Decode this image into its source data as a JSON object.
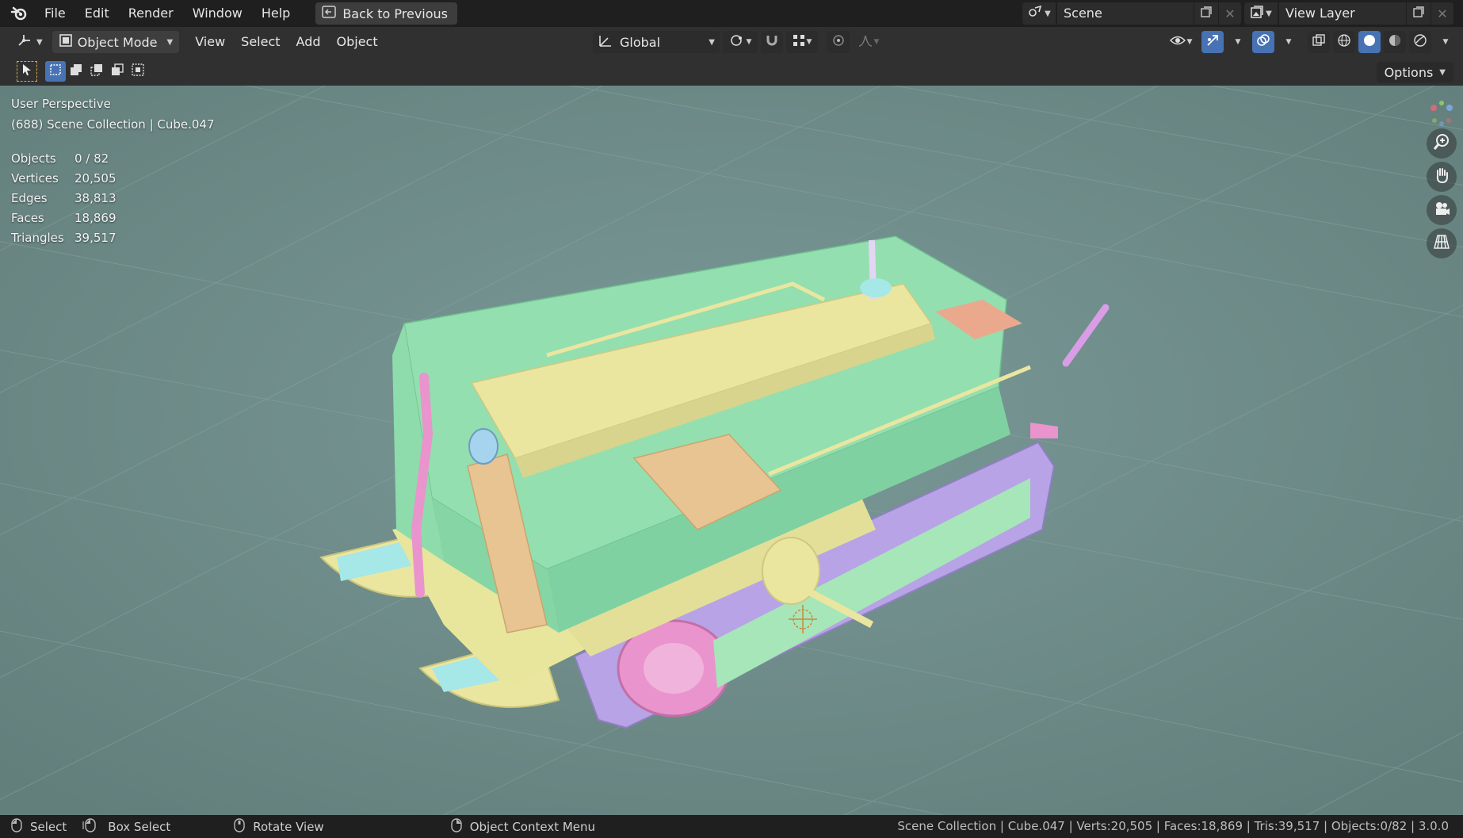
{
  "topbar": {
    "menus": [
      "File",
      "Edit",
      "Render",
      "Window",
      "Help"
    ],
    "back_button": "Back to Previous",
    "scene_name": "Scene",
    "view_layer_name": "View Layer"
  },
  "header": {
    "mode": "Object Mode",
    "menus": [
      "View",
      "Select",
      "Add",
      "Object"
    ],
    "orientation": "Global"
  },
  "toolbar": {
    "options_label": "Options"
  },
  "viewport": {
    "perspective": "User Perspective",
    "collection_info": "(688) Scene Collection | Cube.047",
    "stats": [
      {
        "label": "Objects",
        "value": "0 / 82"
      },
      {
        "label": "Vertices",
        "value": "20,505"
      },
      {
        "label": "Edges",
        "value": "38,813"
      },
      {
        "label": "Faces",
        "value": "18,869"
      },
      {
        "label": "Triangles",
        "value": "39,517"
      }
    ],
    "colors": {
      "background": "#6f8f8c",
      "body_green": "#93dfb0",
      "trim_yellow": "#eae6a0",
      "wood_tan": "#e9c493",
      "track_purple": "#b7a3e6",
      "accent_pink": "#e994cc",
      "accent_cyan": "#a6e7e8"
    }
  },
  "statusbar": {
    "select_label": "Select",
    "box_select_label": "Box Select",
    "rotate_label": "Rotate View",
    "context_label": "Object Context Menu",
    "info": "Scene Collection | Cube.047 | Verts:20,505 | Faces:18,869 | Tris:39,517 | Objects:0/82 | 3.0.0"
  }
}
